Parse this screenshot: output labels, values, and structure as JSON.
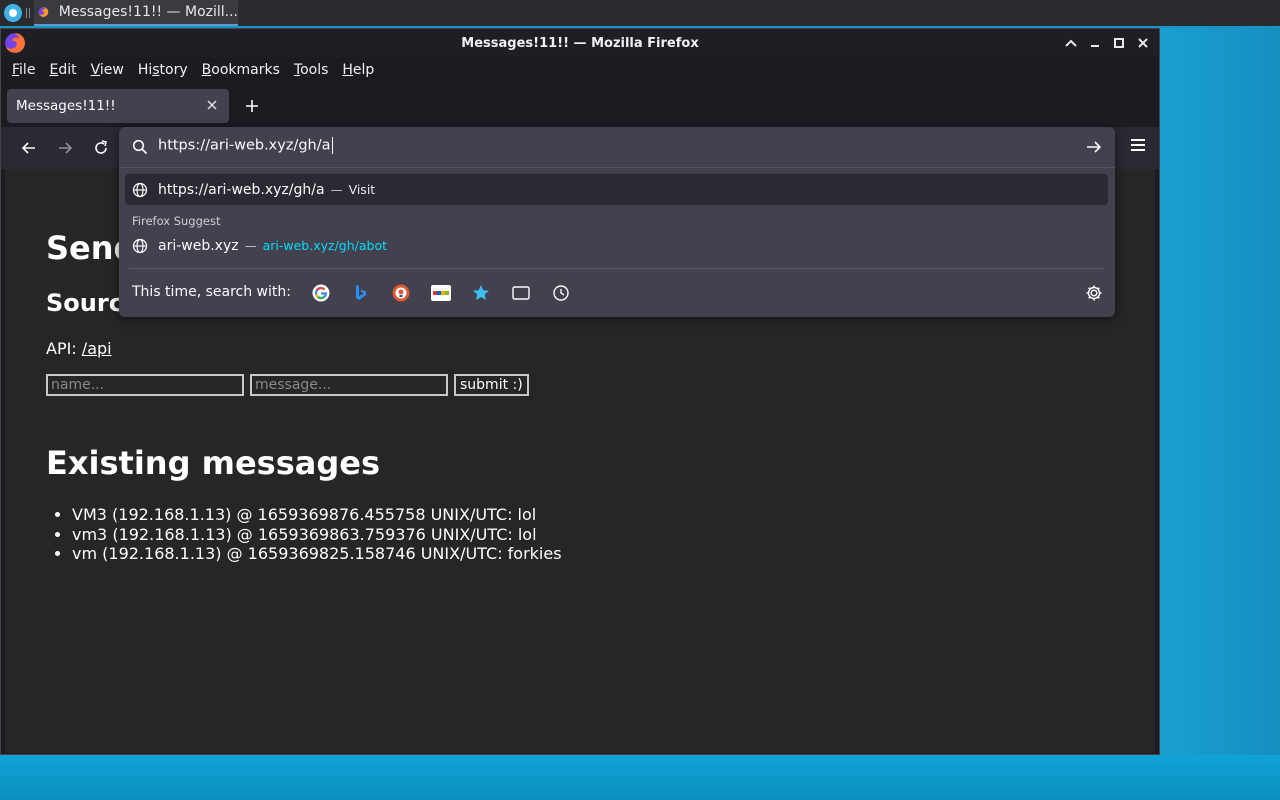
{
  "taskbar": {
    "task_label": "Messages!11!! — Mozill..."
  },
  "window": {
    "title": "Messages!11!! — Mozilla Firefox",
    "menu": [
      "File",
      "Edit",
      "View",
      "History",
      "Bookmarks",
      "Tools",
      "Help"
    ],
    "menu_access_keys": [
      "F",
      "E",
      "V",
      "s",
      "B",
      "T",
      "H"
    ]
  },
  "tabs": [
    {
      "label": "Messages!11!!",
      "active": true
    }
  ],
  "urlbar": {
    "value": "https://ari-web.xyz/gh/a",
    "results": [
      {
        "title": "https://ari-web.xyz/gh/a",
        "separator": "—",
        "action": "Visit"
      }
    ],
    "suggest_group_label": "Firefox Suggest",
    "suggestions": [
      {
        "title": "ari-web.xyz",
        "separator": "—",
        "url": "ari-web.xyz/gh/abot"
      }
    ],
    "search_with_label": "This time, search with:",
    "engines": [
      "google-icon",
      "bing-icon",
      "duckduckgo-icon",
      "ebay-icon",
      "bookmarks-icon",
      "tabs-icon",
      "history-icon"
    ]
  },
  "page": {
    "heading_visible": "Send",
    "subheading_visible": "Sourc",
    "api_prefix": "API:",
    "api_link": "/api",
    "name_placeholder": "name...",
    "message_placeholder": "message...",
    "submit_label": "submit :)",
    "existing_heading": "Existing messages",
    "messages": [
      "VM3 (192.168.1.13) @ 1659369876.455758 UNIX/UTC: lol",
      "vm3 (192.168.1.13) @ 1659369863.759376 UNIX/UTC: lol",
      "vm (192.168.1.13) @ 1659369825.158746 UNIX/UTC: forkies"
    ]
  },
  "colors": {
    "accent_link": "#00ddff",
    "page_bg": "#262626",
    "panel_bg": "#42414d"
  }
}
